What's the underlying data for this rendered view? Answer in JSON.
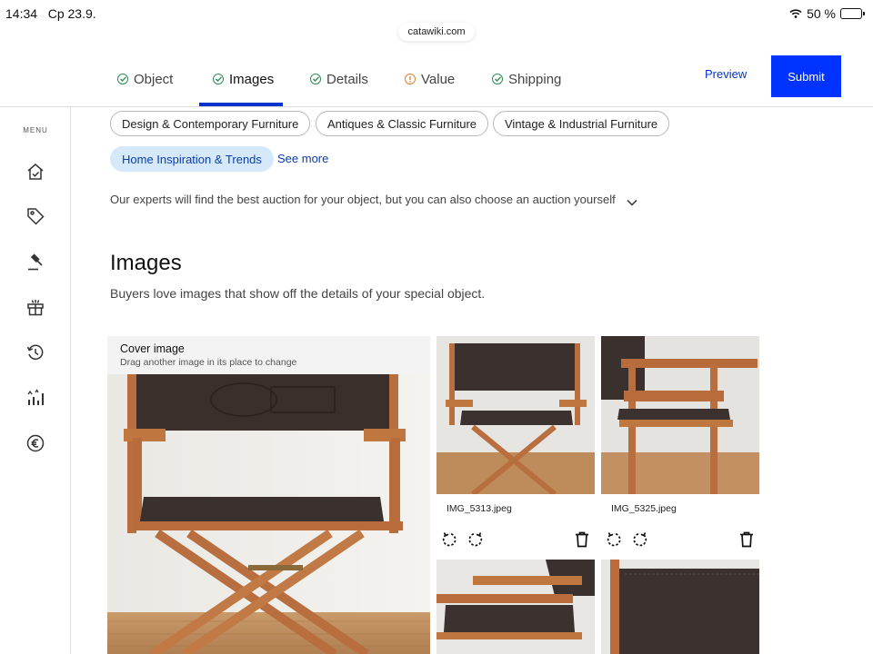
{
  "status": {
    "time": "14:34",
    "date": "Ср 23.9.",
    "battery": "50 %",
    "battery_level": 0.5
  },
  "browser": {
    "url": "catawiki.com"
  },
  "tabs": [
    {
      "label": "Object",
      "state": "done",
      "icon": "check-circle-icon"
    },
    {
      "label": "Images",
      "state": "active",
      "icon": "check-circle-icon"
    },
    {
      "label": "Details",
      "state": "done",
      "icon": "check-circle-icon"
    },
    {
      "label": "Value",
      "state": "warning",
      "icon": "warning-circle-icon"
    },
    {
      "label": "Shipping",
      "state": "done",
      "icon": "check-circle-icon"
    }
  ],
  "actions": {
    "preview": "Preview",
    "submit": "Submit"
  },
  "sidebar": {
    "menu_label": "MENU",
    "icons": [
      "home-icon",
      "tag-icon",
      "auction-hammer-icon",
      "gift-icon",
      "history-icon",
      "stats-icon",
      "euro-icon"
    ]
  },
  "categories": {
    "chips": [
      "Design & Contemporary Furniture",
      "Antiques & Classic Furniture",
      "Vintage & Industrial Furniture",
      "Home Inspiration & Trends"
    ],
    "selected": "Home Inspiration & Trends",
    "see_more": "See more",
    "auction_note": "Our experts will find the best auction for your object, but you can also choose an auction yourself"
  },
  "images_section": {
    "title": "Images",
    "subtitle": "Buyers love images that show off the details of your special object.",
    "cover": {
      "title": "Cover image",
      "hint": "Drag another image in its place to change"
    },
    "files": [
      "IMG_5313.jpeg",
      "IMG_5325.jpeg"
    ]
  },
  "colors": {
    "accent": "#0033ff",
    "link": "#0a3ea8",
    "done": "#2e8b57",
    "warning": "#d9822b",
    "chip_selected": "#d6e9fb"
  }
}
